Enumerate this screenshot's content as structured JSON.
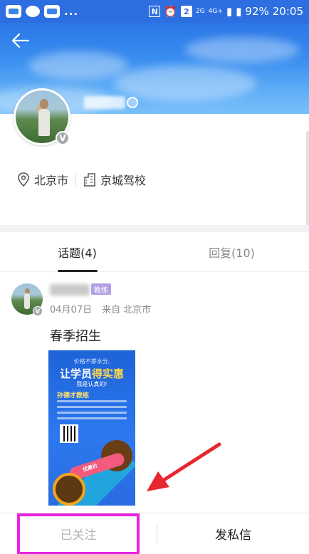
{
  "status_bar": {
    "notifications": [
      "app-icon",
      "wechat-icon",
      "app-icon"
    ],
    "more": "...",
    "indicators": [
      "nfc-icon",
      "alarm-icon",
      "sim2-icon",
      "2g-signal-icon",
      "4g-signal-icon"
    ],
    "sim_label": "2",
    "net_2g": "2G",
    "net_4g": "4G+",
    "battery": "92%",
    "time": "20:05"
  },
  "header": {
    "back_icon": "back-arrow-icon",
    "name": "",
    "gender_icon": "gender-icon",
    "verified_badge": "V"
  },
  "profile": {
    "city": "北京市",
    "school": "京城驾校",
    "city_icon": "location-pin-icon",
    "school_icon": "building-icon"
  },
  "tabs": [
    {
      "label": "话题(4)",
      "active": true
    },
    {
      "label": "回复(10)",
      "active": false
    }
  ],
  "post": {
    "author_tag": "教练",
    "date": "04月07日",
    "source": "来自 北京市",
    "title": "春季招生",
    "verified_badge": "V",
    "poster": {
      "line1": "价格不掺水分,",
      "line2_pre": "让学员",
      "line2_accent": "得实惠",
      "line3": "我是认真的!",
      "coach": "孙德才教练",
      "label": "优惠价"
    }
  },
  "bottom_bar": {
    "follow_label": "已关注",
    "message_label": "发私信"
  },
  "colors": {
    "header_blue": "#2d6ee0",
    "highlight_magenta": "#ea22e4",
    "arrow_red": "#e8262f",
    "coach_tag": "#b3a1e6"
  }
}
